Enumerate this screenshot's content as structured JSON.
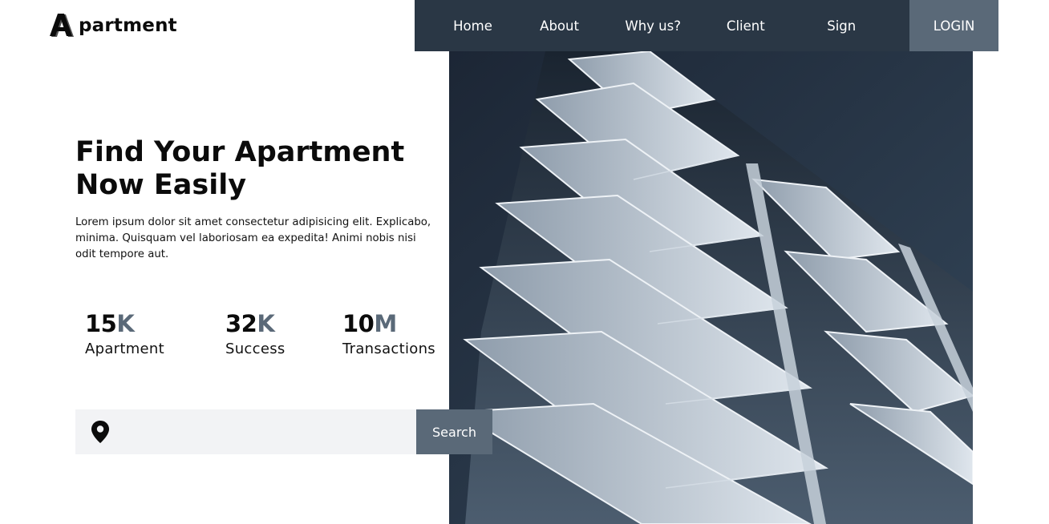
{
  "brand": {
    "logo_letter": "A",
    "name": "partment"
  },
  "nav": {
    "items": [
      {
        "label": "Home"
      },
      {
        "label": "About"
      },
      {
        "label": "Why us?"
      },
      {
        "label": "Client"
      },
      {
        "label": "Sign"
      }
    ],
    "login_label": "LOGIN"
  },
  "hero": {
    "headline_line1": "Find Your Apartment",
    "headline_line2": "Now Easily",
    "description": "Lorem ipsum dolor sit amet consectetur adipisicing elit. Explicabo, minima. Quisquam vel laboriosam ea expedita! Animi nobis nisi odit tempore aut.",
    "image": "apartment-building-photo"
  },
  "stats": [
    {
      "number": "15",
      "suffix": "K",
      "label": "Apartment"
    },
    {
      "number": "32",
      "suffix": "K",
      "label": "Success"
    },
    {
      "number": "10",
      "suffix": "M",
      "label": "Transactions"
    }
  ],
  "search": {
    "icon": "location-pin-icon",
    "value": "",
    "placeholder": "",
    "button_label": "Search"
  },
  "colors": {
    "nav_bg": "#2a3745",
    "accent": "#5a6978",
    "search_bg": "#f2f3f5",
    "text": "#0b0b0b"
  }
}
